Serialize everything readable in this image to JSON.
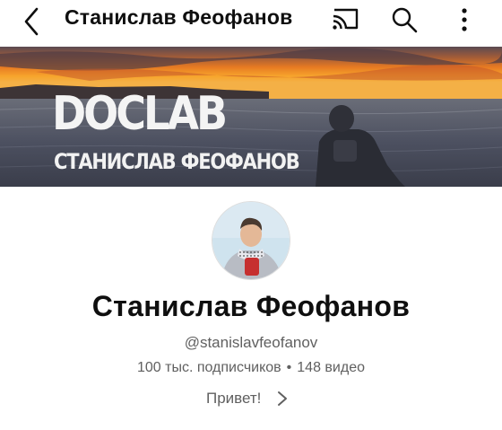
{
  "header": {
    "title": "Станислав Феофанов",
    "icons": [
      "back-arrow-icon",
      "cast-icon",
      "search-icon",
      "more-vert-icon"
    ]
  },
  "banner": {
    "line1": "DOCLAB",
    "line2": "СТАНИСЛАВ ФЕОФАНОВ"
  },
  "channel": {
    "name": "Станислав Феофанов",
    "handle": "@stanislavfeofanov",
    "subscribers": "100 тыс. подписчиков",
    "separator": "•",
    "videos": "148 видео",
    "about": "Привет!"
  },
  "colors": {
    "text_primary": "#0f0f0f",
    "text_secondary": "#606060",
    "background": "#ffffff"
  }
}
